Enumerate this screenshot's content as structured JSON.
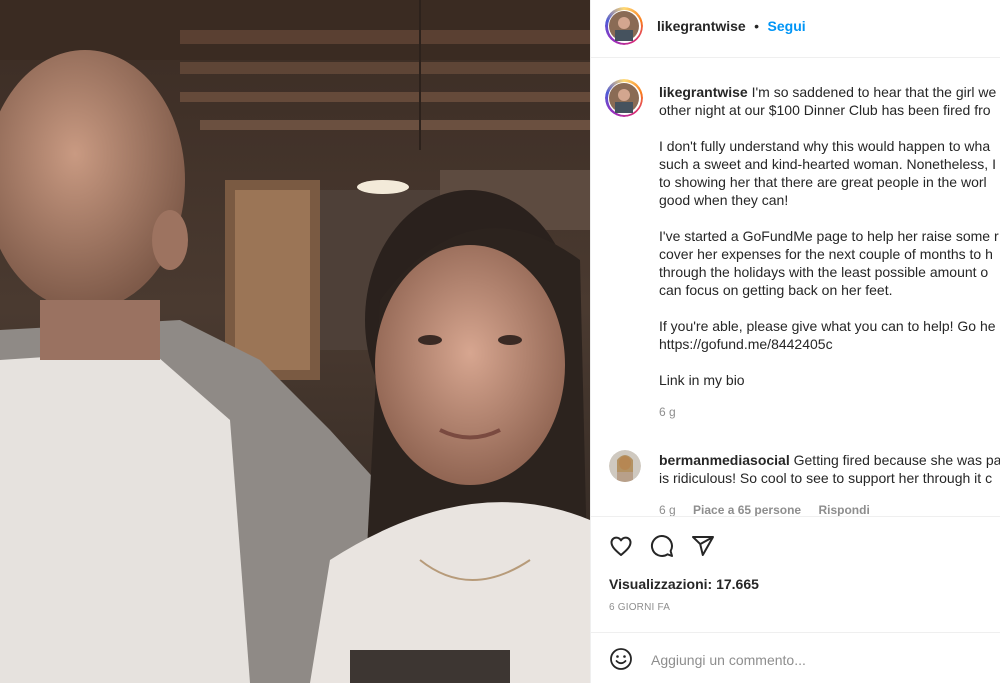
{
  "media": {
    "description_icon": "photo-media"
  },
  "header": {
    "username": "likegrantwise",
    "separator": "•",
    "follow_label": "Segui"
  },
  "caption": {
    "username": "likegrantwise",
    "line1": "I'm so saddened to hear that the girl we",
    "line2": "other night at our $100 Dinner Club has been fired fro",
    "para2_line1": "I don't fully understand why this would happen to wha",
    "para2_line2": "such a sweet and kind-hearted woman. Nonetheless, I",
    "para2_line3": "to showing her that there are great people in the worl",
    "para2_line4": "good when they can!",
    "para3_line1": "I've started a GoFundMe page to help her raise some r",
    "para3_line2": "cover her expenses for the next couple of months to h",
    "para3_line3": "through the holidays with the least possible amount o",
    "para3_line4": "can focus on getting back on her feet.",
    "para4_line1": "If you're able, please give what you can to help! Go he",
    "para4_line2": "https://gofund.me/8442405c",
    "para5": "Link in my bio",
    "time": "6 g"
  },
  "comment": {
    "username": "bermanmediasocial",
    "line1": "Getting fired because she was par",
    "line2": "is ridiculous! So cool to see to support her through it c",
    "time": "6 g",
    "likes": "Piace a 65 persone",
    "reply_label": "Rispondi"
  },
  "actions": {
    "views_label": "Visualizzazioni: 17.665",
    "date_label": "6 GIORNI FA"
  },
  "add_comment": {
    "placeholder": "Aggiungi un commento..."
  },
  "colors": {
    "follow_blue": "#0095f6",
    "text": "#262626",
    "secondary": "#8e8e8e",
    "divider": "#efefef"
  }
}
